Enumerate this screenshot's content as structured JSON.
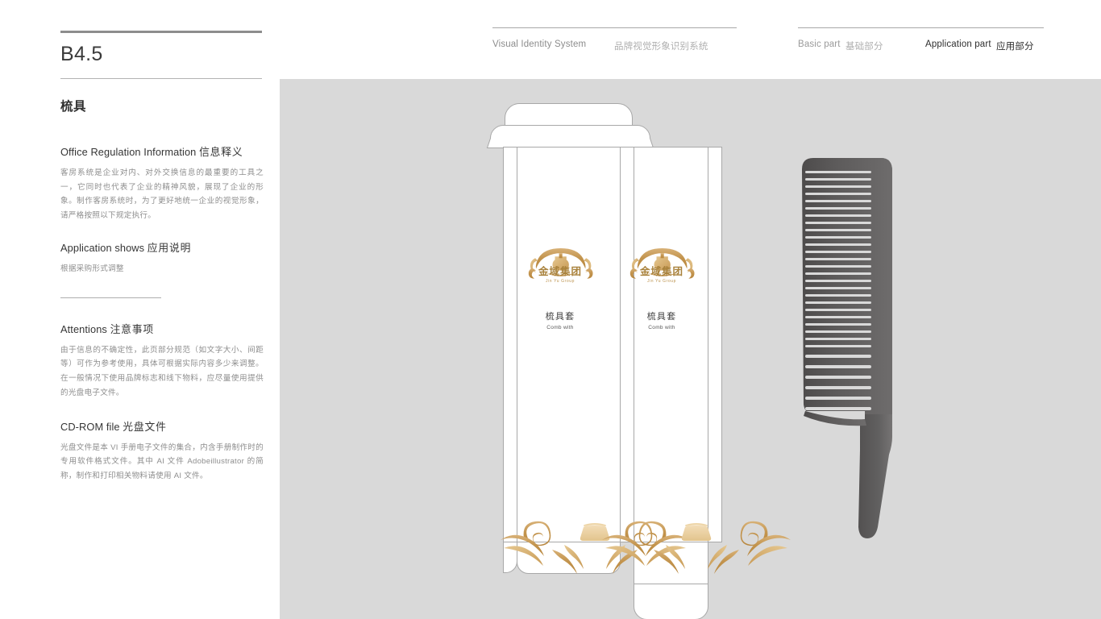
{
  "header": {
    "page_code": "B4.5",
    "vis_en": "Visual Identity System",
    "vis_cn": "品牌视觉形象识别系统",
    "basic_en": "Basic part",
    "basic_cn": "基础部分",
    "app_en": "Application part",
    "app_cn": "应用部分"
  },
  "sidebar": {
    "section_title": "梳具",
    "blocks": [
      {
        "heading_en": "Office Regulation Information",
        "heading_cn": "信息释义",
        "body": "客房系统是企业对内、对外交换信息的最重要的工具之一，它同时也代表了企业的精神风貌，展现了企业的形象。制作客房系统时，为了更好地统一企业的视觉形象，请严格按照以下规定执行。"
      },
      {
        "heading_en": "Application shows",
        "heading_cn": "应用说明",
        "body": "根据采购形式调整"
      },
      {
        "heading_en": "Attentions",
        "heading_cn": "注意事项",
        "body": "由于信息的不确定性，此页部分规范（如文字大小、间距等）可作为参考使用，具体可根据实际内容多少来调整。在一般情况下使用品牌标志和线下物料，应尽量使用提供的光盘电子文件。"
      },
      {
        "heading_en": "CD-ROM file",
        "heading_cn": "光盘文件",
        "body": "光盘文件是本 VI 手册电子文件的集合，内含手册制作时的专用软件格式文件。其中 AI 文件 Adobeillustrator 的简称，制作和打印相关物料请使用 AI 文件。"
      }
    ]
  },
  "artwork": {
    "background_color": "#d9d9d9",
    "package": {
      "brand_logo_cn": "金域集团",
      "brand_logo_en": "Jin Yu Group",
      "panel_front": {
        "product_cn": "梳具套",
        "product_en": "Comb with"
      },
      "panel_back": {
        "product_cn": "梳具套",
        "product_en": "Comb with"
      },
      "ornament_name": "gold-wave-scroll-pattern",
      "gold_color": "#c79a52",
      "dieline_color": "#a8a8a8",
      "panel_color": "#ffffff"
    },
    "comb": {
      "label": "comb-illustration",
      "color": "#595757"
    }
  }
}
